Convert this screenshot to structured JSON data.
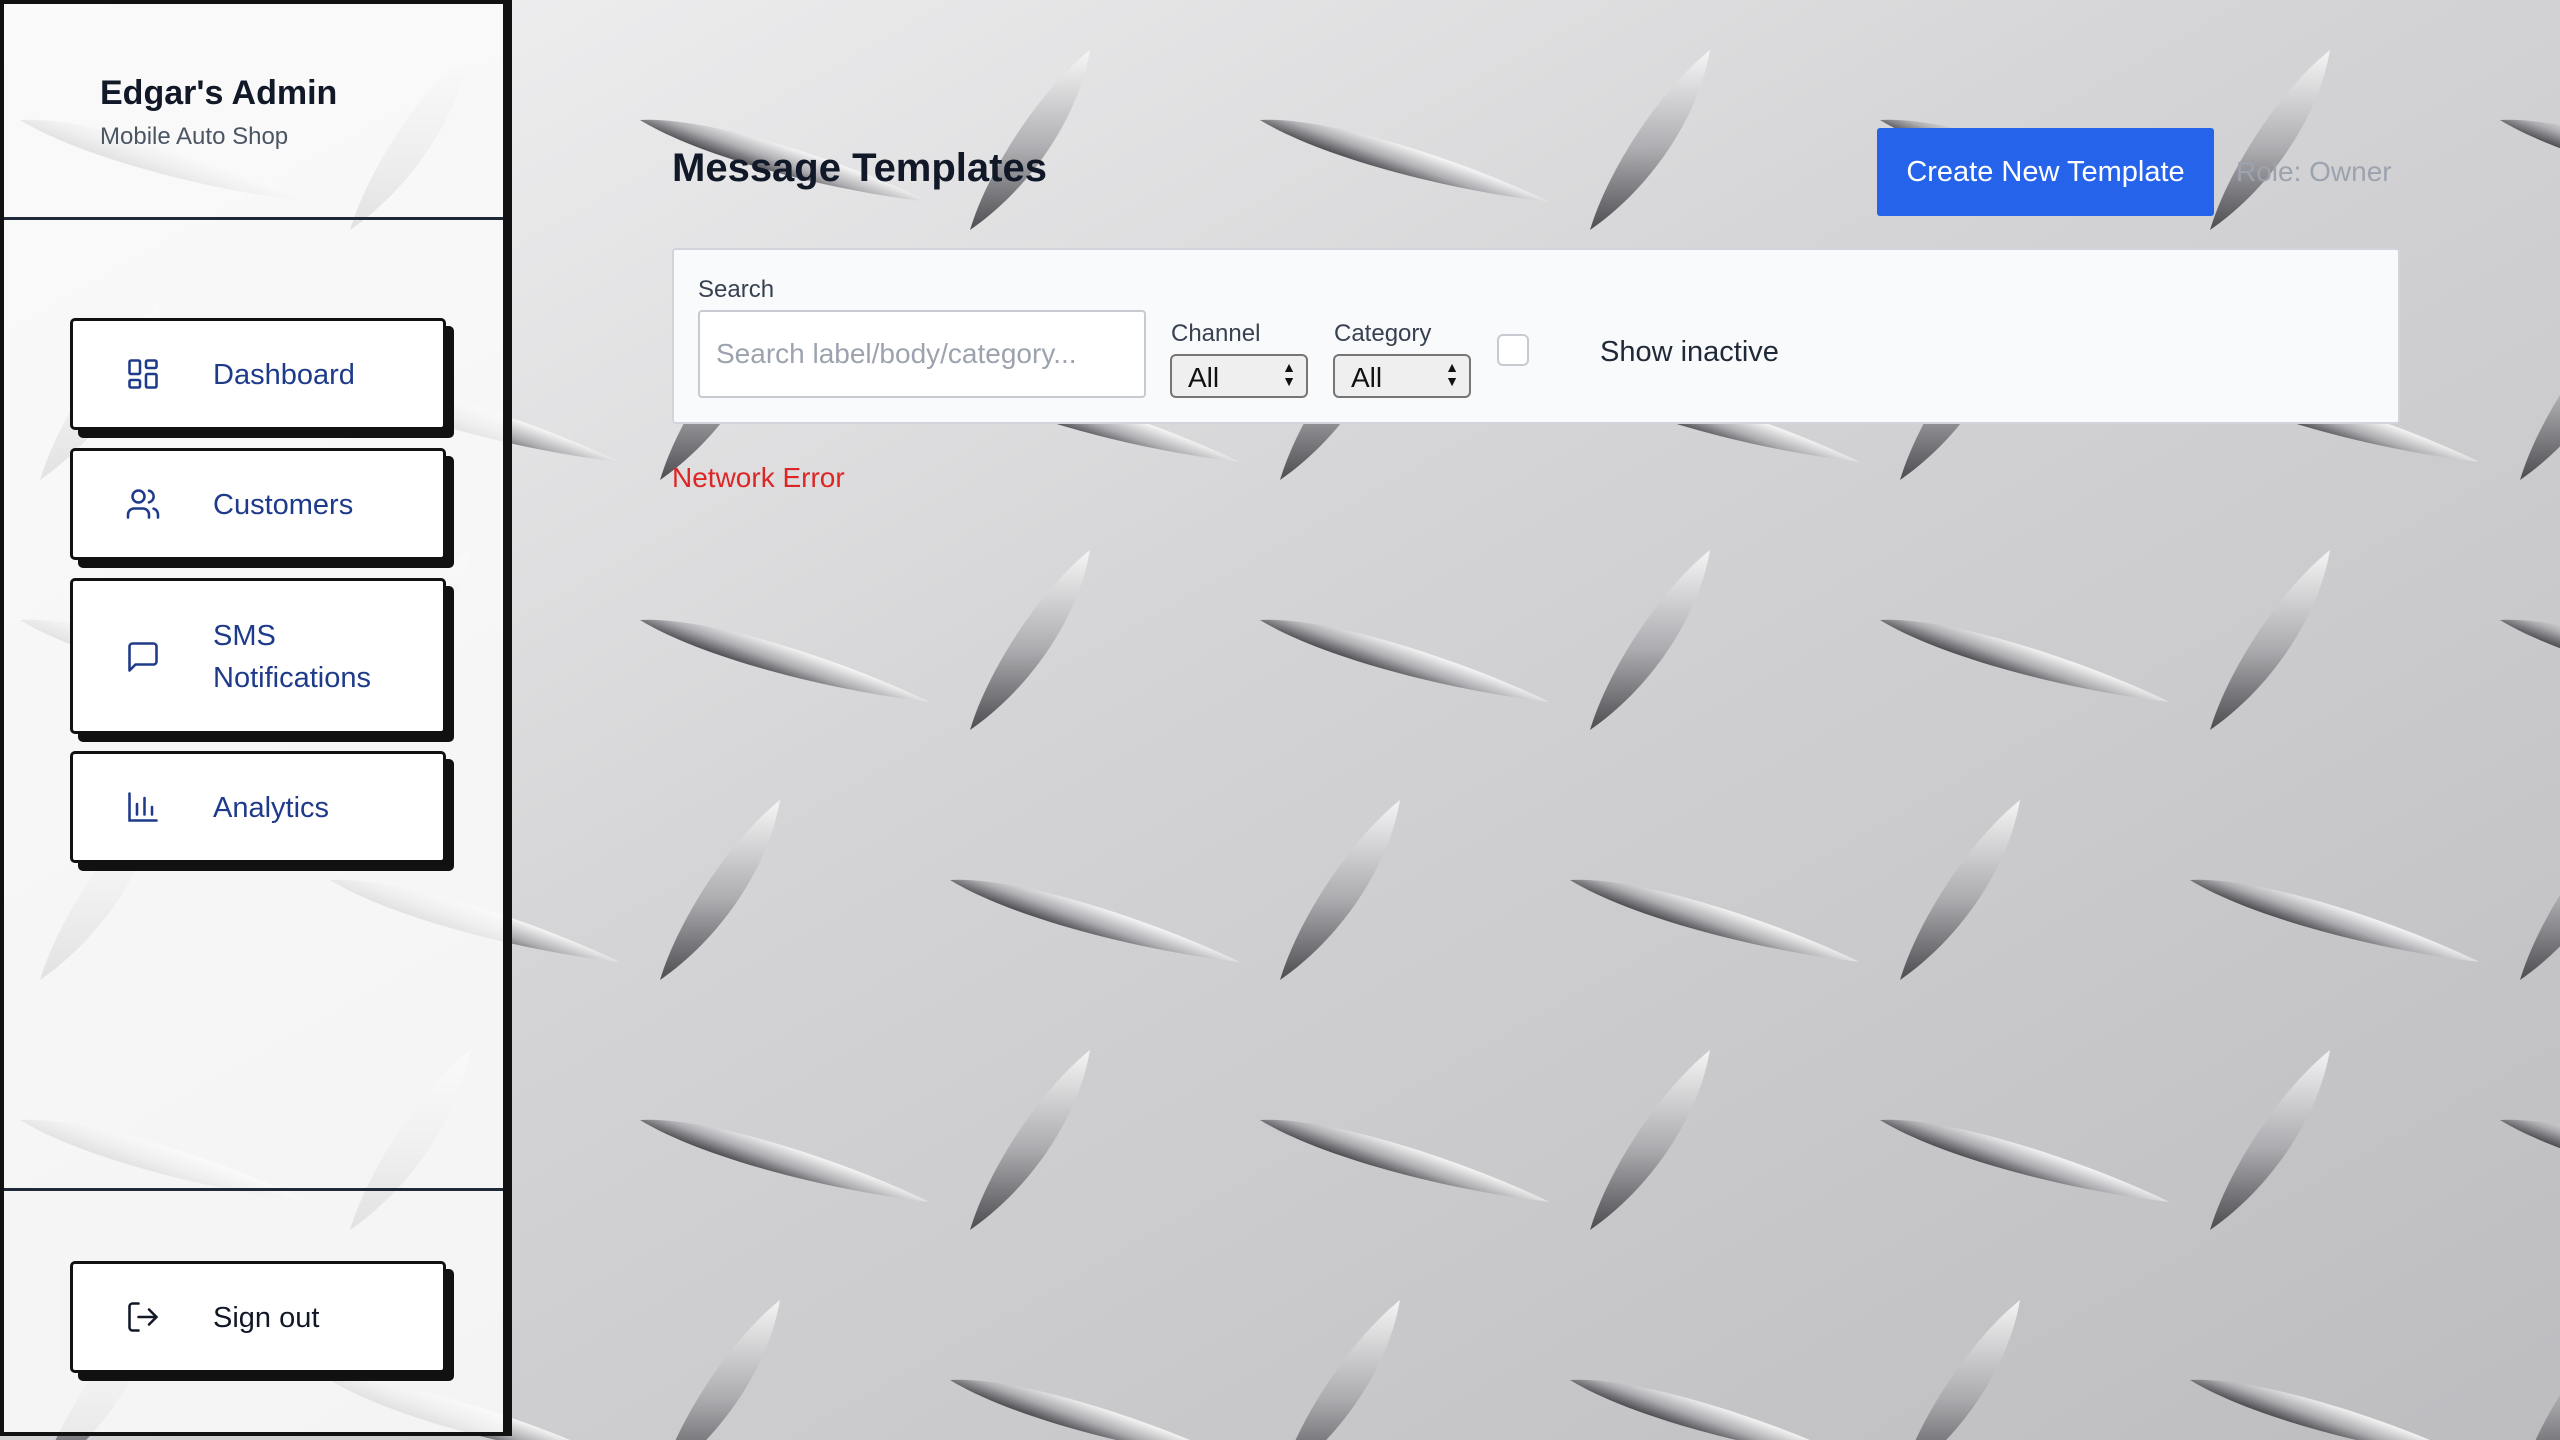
{
  "sidebar": {
    "title": "Edgar's Admin",
    "subtitle": "Mobile Auto Shop",
    "items": [
      {
        "label": "Dashboard",
        "icon": "grid-icon"
      },
      {
        "label": "Customers",
        "icon": "users-icon"
      },
      {
        "label": "SMS Notifications",
        "icon": "message-icon"
      },
      {
        "label": "Analytics",
        "icon": "bar-chart-icon"
      }
    ],
    "signout": {
      "label": "Sign out",
      "icon": "sign-out-icon"
    }
  },
  "header": {
    "title": "Message Templates",
    "create_label": "Create New Template",
    "role_text": "Role: Owner"
  },
  "filters": {
    "search_label": "Search",
    "search_placeholder": "Search label/body/category...",
    "search_value": "",
    "channel_label": "Channel",
    "channel_value": "All",
    "category_label": "Category",
    "category_value": "All",
    "show_inactive_label": "Show inactive",
    "show_inactive_checked": false
  },
  "status": {
    "error": "Network Error"
  },
  "colors": {
    "accent": "#2563eb",
    "nav_text": "#1e3a8a",
    "error": "#dc2626"
  }
}
